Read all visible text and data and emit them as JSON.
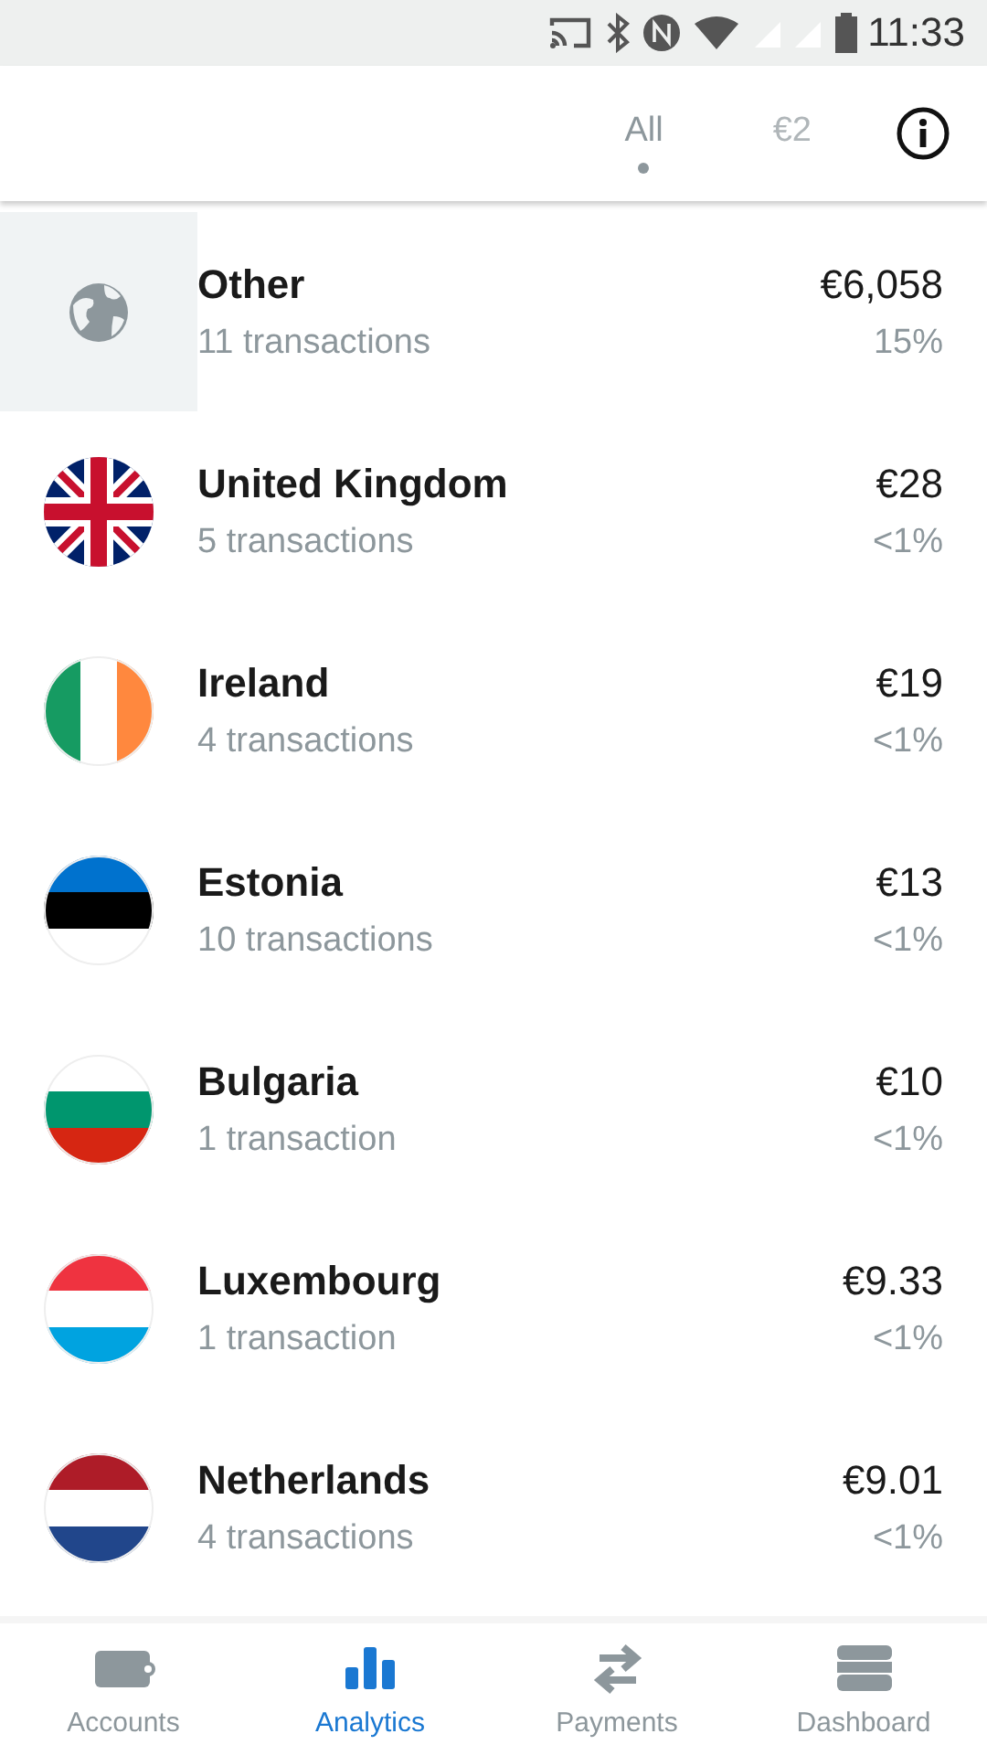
{
  "status_bar": {
    "time": "11:33"
  },
  "tabs": [
    {
      "label": "All",
      "selected": true
    },
    {
      "label": "€2",
      "selected": false
    }
  ],
  "countries": [
    {
      "name": "Other",
      "count": "11 transactions",
      "amount": "€6,058",
      "share": "15%",
      "kind": "globe",
      "selected": true
    },
    {
      "name": "United Kingdom",
      "count": "5 transactions",
      "amount": "€28",
      "share": "<1%",
      "kind": "union",
      "selected": false
    },
    {
      "name": "Ireland",
      "count": "4 transactions",
      "amount": "€19",
      "share": "<1%",
      "kind": "ireland",
      "selected": false
    },
    {
      "name": "Estonia",
      "count": "10 transactions",
      "amount": "€13",
      "share": "<1%",
      "kind": "estonia",
      "selected": false
    },
    {
      "name": "Bulgaria",
      "count": "1 transaction",
      "amount": "€10",
      "share": "<1%",
      "kind": "bulgaria",
      "selected": false
    },
    {
      "name": "Luxembourg",
      "count": "1 transaction",
      "amount": "€9.33",
      "share": "<1%",
      "kind": "luxembourg",
      "selected": false
    },
    {
      "name": "Netherlands",
      "count": "4 transactions",
      "amount": "€9.01",
      "share": "<1%",
      "kind": "netherlands",
      "selected": false
    }
  ],
  "nav": [
    {
      "label": "Accounts",
      "kind": "wallet",
      "selected": false
    },
    {
      "label": "Analytics",
      "kind": "chart",
      "selected": true
    },
    {
      "label": "Payments",
      "kind": "transfer",
      "selected": false
    },
    {
      "label": "Dashboard",
      "kind": "stack",
      "selected": false
    }
  ]
}
